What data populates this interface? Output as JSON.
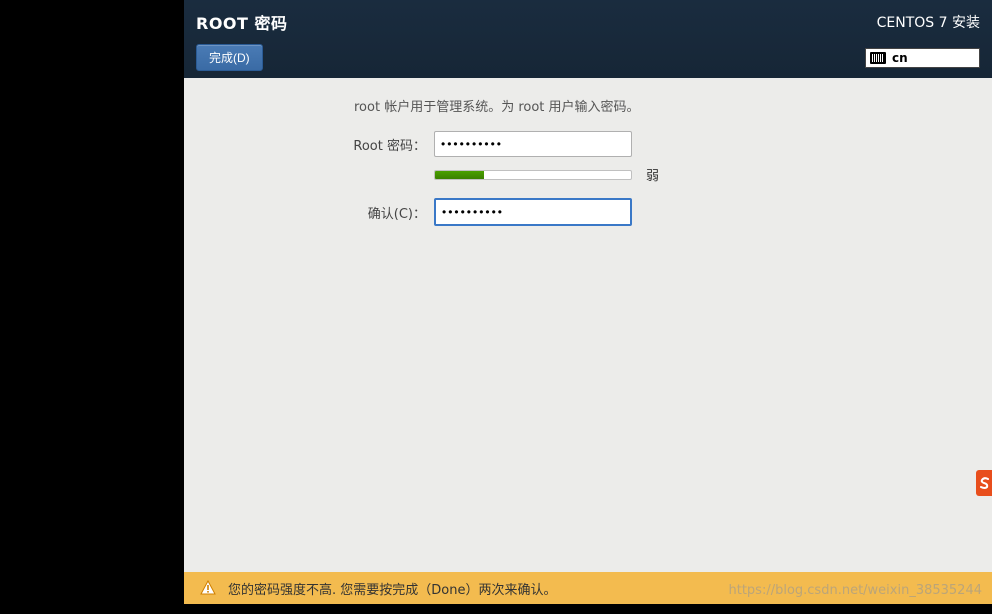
{
  "header": {
    "title": "ROOT 密码",
    "branding": "CENTOS 7 安装",
    "done_label": "完成(D)",
    "keyboard_layout": "cn"
  },
  "content": {
    "description": "root 帐户用于管理系统。为 root 用户输入密码。",
    "password_label": "Root 密码：",
    "confirm_label": "确认(C)：",
    "password_value": "●●●●●●●●●●",
    "confirm_value": "●●●●●●●●●●",
    "strength_label": "弱",
    "strength_percent": 25
  },
  "warning": {
    "message": "您的密码强度不高. 您需要按完成（Done）两次来确认。"
  },
  "watermark": "https://blog.csdn.net/weixin_38535244"
}
